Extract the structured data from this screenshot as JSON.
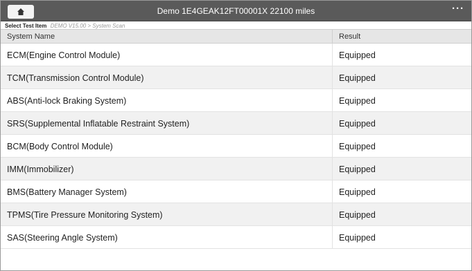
{
  "header": {
    "title": "Demo  1E4GEAK12FT00001X  22100 miles",
    "home_icon": "home-icon",
    "more_label": "···"
  },
  "breadcrumb": {
    "label": "Select Test Item",
    "path": "DEMO V15.00 > System Scan"
  },
  "table": {
    "columns": [
      "System Name",
      "Result"
    ],
    "rows": [
      {
        "name": "ECM(Engine Control Module)",
        "result": "Equipped"
      },
      {
        "name": "TCM(Transmission Control Module)",
        "result": "Equipped"
      },
      {
        "name": "ABS(Anti-lock Braking System)",
        "result": "Equipped"
      },
      {
        "name": "SRS(Supplemental Inflatable Restraint System)",
        "result": "Equipped"
      },
      {
        "name": "BCM(Body Control Module)",
        "result": "Equipped"
      },
      {
        "name": "IMM(Immobilizer)",
        "result": "Equipped"
      },
      {
        "name": "BMS(Battery Manager System)",
        "result": "Equipped"
      },
      {
        "name": "TPMS(Tire Pressure Monitoring System)",
        "result": "Equipped"
      },
      {
        "name": "SAS(Steering Angle System)",
        "result": "Equipped"
      }
    ]
  },
  "colors": {
    "topbar": "#5a5a5a",
    "header_row": "#e6e6e6",
    "stripe": "#f1f1f1"
  }
}
